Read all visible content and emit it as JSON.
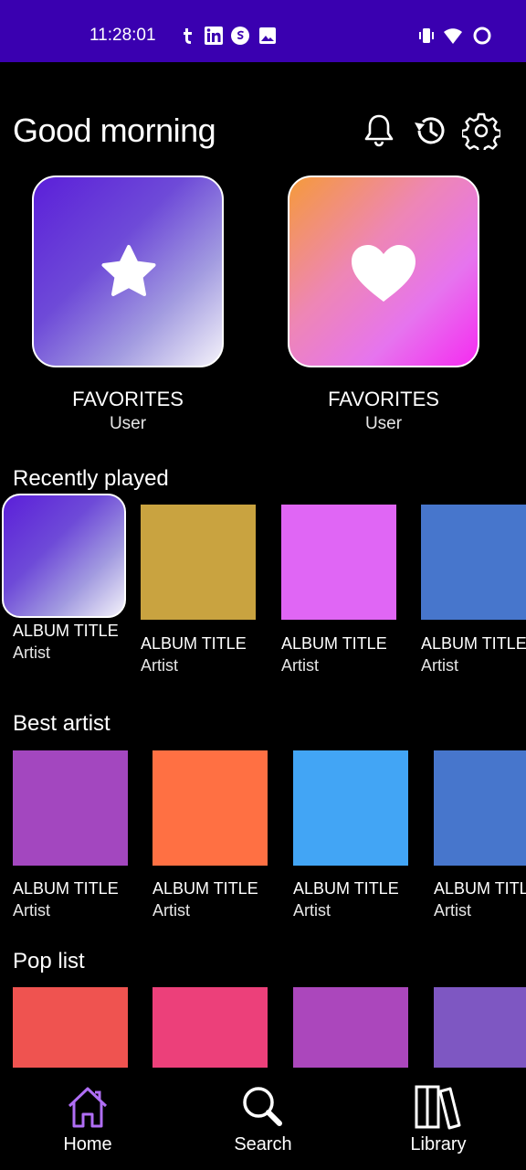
{
  "status_bar": {
    "time": "11:28:01",
    "icons": [
      "tumblr-icon",
      "linkedin-icon",
      "circle-app-icon",
      "image-icon",
      "vibrate-icon",
      "wifi-icon",
      "battery-ring-icon"
    ],
    "background": "#3a00b0"
  },
  "header": {
    "greeting": "Good morning",
    "actions": [
      "bell-icon",
      "history-icon",
      "gear-icon"
    ]
  },
  "favorites": [
    {
      "title": "FAVORITES",
      "subtitle": "User",
      "icon": "star-icon"
    },
    {
      "title": "FAVORITES",
      "subtitle": "User",
      "icon": "heart-icon"
    }
  ],
  "sections": {
    "recently_played": {
      "title": "Recently played",
      "items": [
        {
          "title": "ALBUM TITLE",
          "artist": "Artist",
          "color": "gradient-purple"
        },
        {
          "title": "ALBUM TITLE",
          "artist": "Artist",
          "color": "#c9a340"
        },
        {
          "title": "ALBUM TITLE",
          "artist": "Artist",
          "color": "#e066f5"
        },
        {
          "title": "ALBUM TITLE",
          "artist": "Artist",
          "color": "#4776cc"
        }
      ]
    },
    "best_artist": {
      "title": "Best artist",
      "items": [
        {
          "title": "ALBUM TITLE",
          "artist": "Artist",
          "color": "#a347bf"
        },
        {
          "title": "ALBUM TITLE",
          "artist": "Artist",
          "color": "#ff7043"
        },
        {
          "title": "ALBUM TITLE",
          "artist": "Artist",
          "color": "#42a5f5"
        },
        {
          "title": "ALBUM TITLE",
          "artist": "Artist",
          "color": "#4776cc"
        }
      ]
    },
    "pop_list": {
      "title": "Pop list",
      "items": [
        {
          "color": "#ef5350"
        },
        {
          "color": "#ec407a"
        },
        {
          "color": "#ab47bc"
        },
        {
          "color": "#7e57c2"
        }
      ]
    }
  },
  "bottom_nav": [
    {
      "label": "Home",
      "icon": "home-icon",
      "active": true
    },
    {
      "label": "Search",
      "icon": "search-icon",
      "active": false
    },
    {
      "label": "Library",
      "icon": "library-icon",
      "active": false
    }
  ],
  "colors": {
    "accent": "#3a00b0",
    "active_nav_icon": "#b06ef5",
    "background": "#000000"
  }
}
